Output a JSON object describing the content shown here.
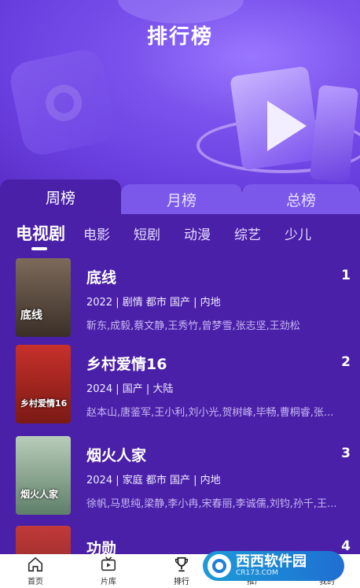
{
  "header": {
    "title": "排行榜"
  },
  "period_tabs": [
    {
      "label": "周榜",
      "active": true
    },
    {
      "label": "月榜",
      "active": false
    },
    {
      "label": "总榜",
      "active": false
    }
  ],
  "genre_tabs": [
    {
      "label": "电视剧",
      "active": true
    },
    {
      "label": "电影",
      "active": false
    },
    {
      "label": "短剧",
      "active": false
    },
    {
      "label": "动漫",
      "active": false
    },
    {
      "label": "综艺",
      "active": false
    },
    {
      "label": "少儿",
      "active": false
    }
  ],
  "items": [
    {
      "rank": "1",
      "title": "底线",
      "meta": "2022 | 剧情 都市 国产 | 内地",
      "cast": "靳东,成毅,蔡文静,王秀竹,曾梦雪,张志坚,王劲松",
      "poster_text": "底线"
    },
    {
      "rank": "2",
      "title": "乡村爱情16",
      "meta": "2024 | 国产 | 大陆",
      "cast": "赵本山,唐鉴军,王小利,刘小光,贺树峰,毕畅,曹桐睿,张...",
      "poster_text": "乡村爱情16"
    },
    {
      "rank": "3",
      "title": "烟火人家",
      "meta": "2024 | 家庭 都市 国产 | 内地",
      "cast": "徐帆,马思纯,梁静,李小冉,宋春丽,李诚儒,刘钧,孙千,王...",
      "poster_text": "烟火人家"
    },
    {
      "rank": "4",
      "title": "功勋",
      "meta": "",
      "cast": "",
      "poster_text": ""
    }
  ],
  "bottom_nav": [
    {
      "label": "首页",
      "icon": "home-icon"
    },
    {
      "label": "片库",
      "icon": "tv-icon"
    },
    {
      "label": "排行",
      "icon": "trophy-icon",
      "active": true
    },
    {
      "label": "推广",
      "icon": "share-icon"
    },
    {
      "label": "我的",
      "icon": "user-icon"
    }
  ],
  "watermark": {
    "text": "西西软件园",
    "sub": "CR173.COM"
  },
  "colors": {
    "accent": "#4a20a8",
    "tab_inactive": "#7c58ea",
    "hero": "#6a3fe0"
  }
}
